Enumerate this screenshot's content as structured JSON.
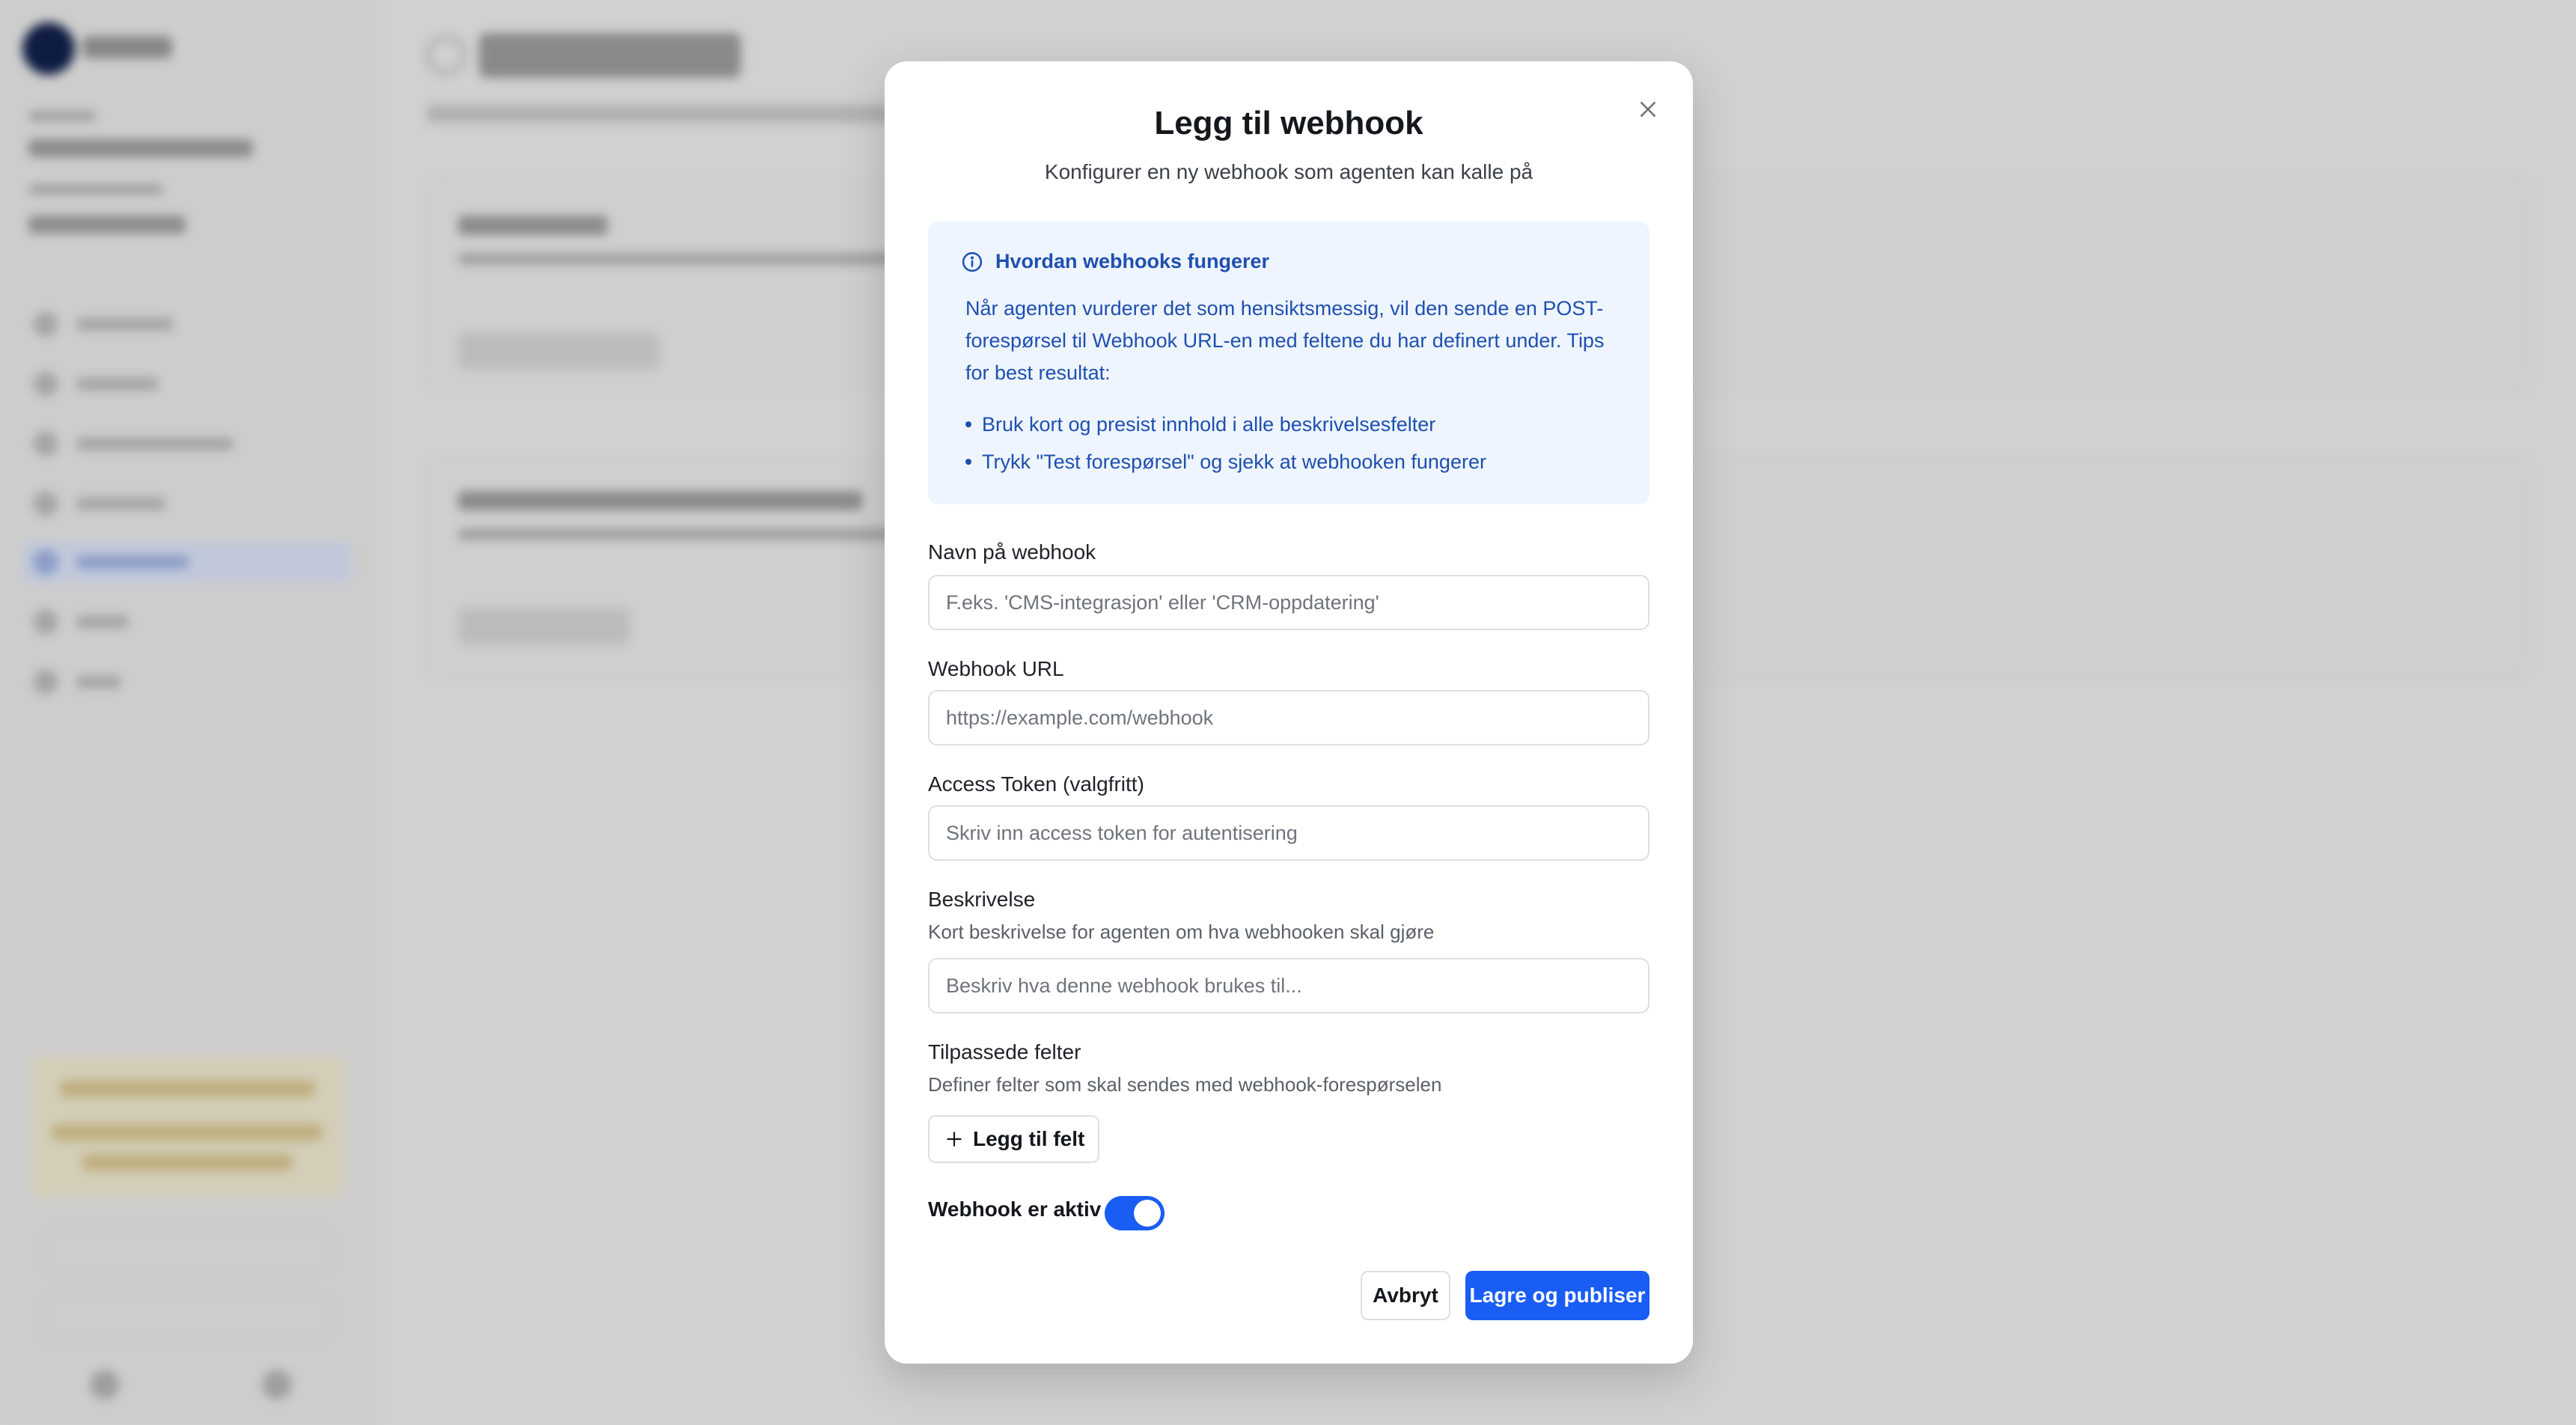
{
  "modal": {
    "title": "Legg til webhook",
    "subtitle": "Konfigurer en ny webhook som agenten kan kalle på",
    "info": {
      "heading": "Hvordan webhooks fungerer",
      "body": "Når agenten vurderer det som hensiktsmessig, vil den sende en POST-forespørsel til Webhook URL-en med feltene du har definert under. Tips for best resultat:",
      "tips": [
        "Bruk kort og presist innhold i alle beskrivelsesfelter",
        "Trykk \"Test forespørsel\" og sjekk at webhooken fungerer"
      ]
    },
    "fields": {
      "name": {
        "label": "Navn på webhook",
        "placeholder": "F.eks. 'CMS-integrasjon' eller 'CRM-oppdatering'",
        "value": ""
      },
      "url": {
        "label": "Webhook URL",
        "placeholder": "https://example.com/webhook",
        "value": ""
      },
      "token": {
        "label": "Access Token (valgfritt)",
        "placeholder": "Skriv inn access token for autentisering",
        "value": ""
      },
      "description": {
        "label": "Beskrivelse",
        "help": "Kort beskrivelse for agenten om hva webhooken skal gjøre",
        "placeholder": "Beskriv hva denne webhook brukes til...",
        "value": ""
      }
    },
    "custom_fields": {
      "label": "Tilpassede felter",
      "help": "Definer felter som skal sendes med webhook-forespørselen",
      "add_button": "Legg til felt"
    },
    "active_toggle": {
      "label": "Webhook er aktiv",
      "on": true
    },
    "buttons": {
      "cancel": "Avbryt",
      "save": "Lagre og publiser"
    }
  },
  "colors": {
    "primary": "#1a5df5",
    "info_bg": "#eef5fe",
    "info_text": "#1f4fb0"
  },
  "icons": {
    "close": "close-icon",
    "info": "info-circle-icon",
    "add": "plus-icon"
  }
}
